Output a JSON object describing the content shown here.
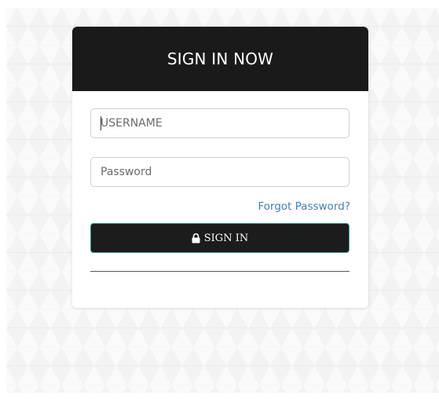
{
  "login": {
    "title": "SIGN IN NOW",
    "username": {
      "placeholder": "USERNAME",
      "value": ""
    },
    "password": {
      "placeholder": "Password",
      "value": ""
    },
    "forgot_link": "Forgot Password?",
    "signin_button": {
      "label": "SIGN IN",
      "icon": "lock-icon"
    }
  },
  "colors": {
    "header_bg": "#1a1a1a",
    "button_bg": "#1c1c1c",
    "button_border": "#2c9c8f",
    "link": "#3b7fc4"
  }
}
